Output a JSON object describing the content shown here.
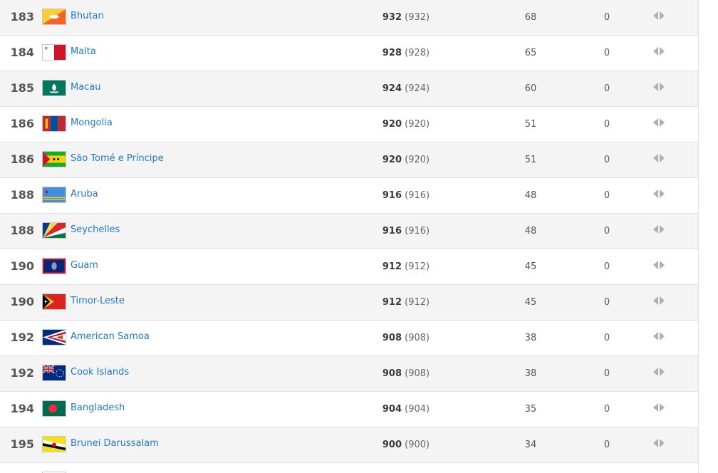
{
  "colors": {
    "link": "#2277c9",
    "alt_row": "#f4f4f4",
    "border": "#e2e2e2",
    "arrow": "#b0b0b0"
  },
  "rows": [
    {
      "rank": "183",
      "team": "Bhutan",
      "flag": "bhutan",
      "points": "932",
      "prev_points": "(932)",
      "matches": "68",
      "change": "0"
    },
    {
      "rank": "184",
      "team": "Malta",
      "flag": "malta",
      "points": "928",
      "prev_points": "(928)",
      "matches": "65",
      "change": "0"
    },
    {
      "rank": "185",
      "team": "Macau",
      "flag": "macau",
      "points": "924",
      "prev_points": "(924)",
      "matches": "60",
      "change": "0"
    },
    {
      "rank": "186",
      "team": "Mongolia",
      "flag": "mongolia",
      "points": "920",
      "prev_points": "(920)",
      "matches": "51",
      "change": "0"
    },
    {
      "rank": "186",
      "team": "São Tomé e Príncipe",
      "flag": "sao-tome",
      "points": "920",
      "prev_points": "(920)",
      "matches": "51",
      "change": "0"
    },
    {
      "rank": "188",
      "team": "Aruba",
      "flag": "aruba",
      "points": "916",
      "prev_points": "(916)",
      "matches": "48",
      "change": "0"
    },
    {
      "rank": "188",
      "team": "Seychelles",
      "flag": "seychelles",
      "points": "916",
      "prev_points": "(916)",
      "matches": "48",
      "change": "0"
    },
    {
      "rank": "190",
      "team": "Guam",
      "flag": "guam",
      "points": "912",
      "prev_points": "(912)",
      "matches": "45",
      "change": "0"
    },
    {
      "rank": "190",
      "team": "Timor-Leste",
      "flag": "timor-leste",
      "points": "912",
      "prev_points": "(912)",
      "matches": "45",
      "change": "0"
    },
    {
      "rank": "192",
      "team": "American Samoa",
      "flag": "american-samoa",
      "points": "908",
      "prev_points": "(908)",
      "matches": "38",
      "change": "0"
    },
    {
      "rank": "192",
      "team": "Cook Islands",
      "flag": "cook-islands",
      "points": "908",
      "prev_points": "(908)",
      "matches": "38",
      "change": "0"
    },
    {
      "rank": "194",
      "team": "Bangladesh",
      "flag": "bangladesh",
      "points": "904",
      "prev_points": "(904)",
      "matches": "35",
      "change": "0"
    },
    {
      "rank": "195",
      "team": "Brunei Darussalam",
      "flag": "brunei",
      "points": "900",
      "prev_points": "(900)",
      "matches": "34",
      "change": "0"
    }
  ]
}
